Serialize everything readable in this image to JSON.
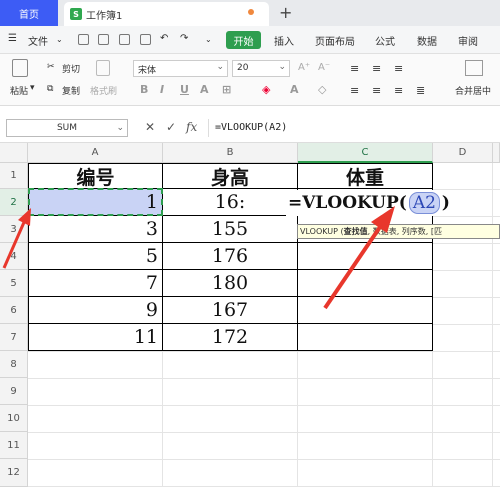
{
  "tabs": {
    "home": "首页",
    "workbook": "工作簿1",
    "new_tab": "+"
  },
  "menu": {
    "file": "文件",
    "start": "开始",
    "insert": "插入",
    "page_layout": "页面布局",
    "formulas": "公式",
    "data": "数据",
    "review": "审阅"
  },
  "ribbon": {
    "paste": "粘贴",
    "cut": "剪切",
    "copy": "复制",
    "format_painter": "格式刷",
    "font_name": "宋体",
    "font_size": "20",
    "merge_center": "合并居中"
  },
  "formula_bar": {
    "name_box": "SUM",
    "cancel_icon": "✕",
    "confirm_icon": "✓",
    "fx_label": "fx",
    "formula": "=VLOOKUP(A2)"
  },
  "columns": [
    "A",
    "B",
    "C",
    "D"
  ],
  "rows": [
    "1",
    "2",
    "3",
    "4",
    "5",
    "6",
    "7",
    "8",
    "9",
    "10",
    "11",
    "12"
  ],
  "table": {
    "headers": [
      "编号",
      "身高",
      "体重"
    ],
    "ids": [
      "1",
      "3",
      "5",
      "7",
      "9",
      "11"
    ],
    "heights": [
      "16:",
      "155",
      "176",
      "180",
      "167",
      "172"
    ]
  },
  "editing": {
    "prefix": "=VLOOKUP(",
    "ref": "A2",
    "suffix": ")",
    "tooltip_func": "VLOOKUP (",
    "tooltip_arg": "查找值",
    "tooltip_rest": ", 数据表, 列序数, [匹"
  },
  "colors": {
    "accent_green": "#2e9e4f",
    "arrow_red": "#e8372c",
    "selection_blue": "#c9d3f5"
  }
}
